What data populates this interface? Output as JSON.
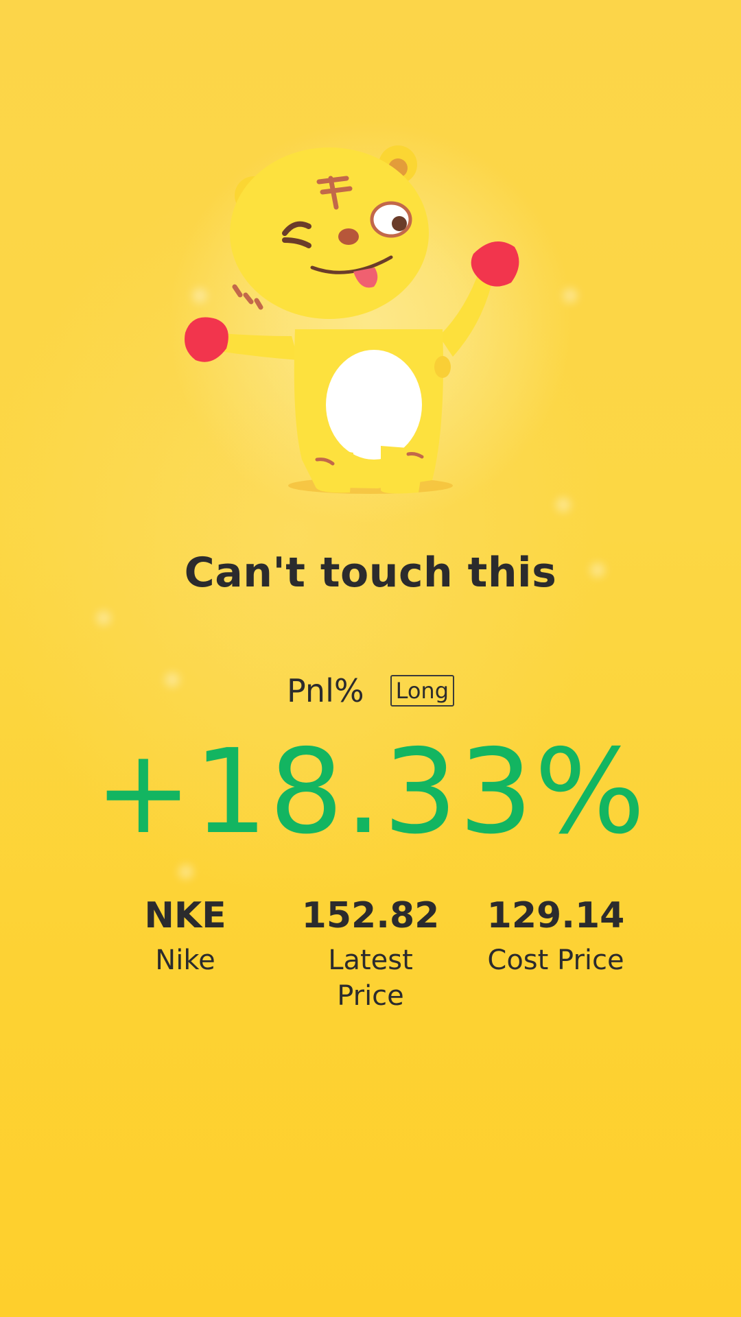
{
  "card": {
    "title": "Can't touch this",
    "pnl_label": "Pnl%",
    "position_badge": "Long",
    "pnl_value": "+18.33%",
    "pnl_color": "#13b561",
    "background_color": "#fbd23a",
    "mascot": "tiger-mascot-winking",
    "stats": [
      {
        "value": "NKE",
        "label": "Nike"
      },
      {
        "value": "152.82",
        "label": "Latest Price"
      },
      {
        "value": "129.14",
        "label": "Cost Price"
      }
    ]
  }
}
